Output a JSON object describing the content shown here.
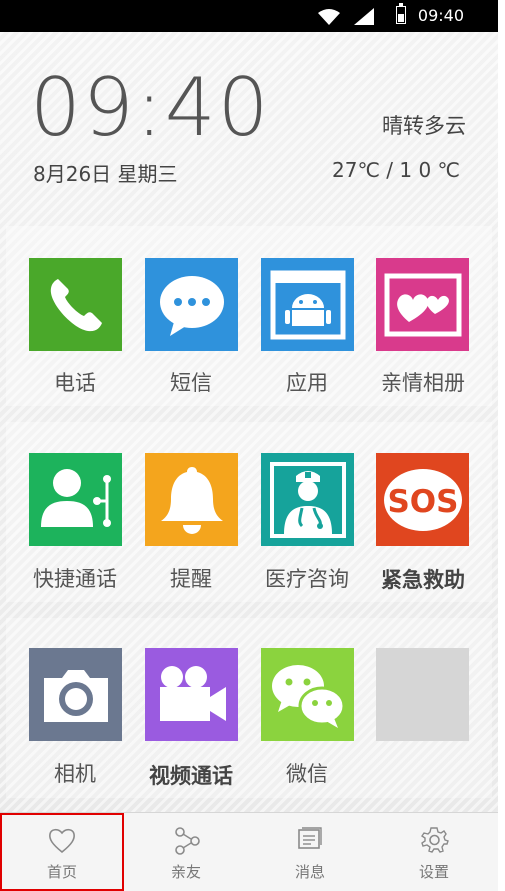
{
  "status_bar": {
    "time": "09:40"
  },
  "header": {
    "clock": "09:40",
    "date": "8月26日  星期三",
    "weather": "晴转多云",
    "temperature": "27℃ / 1 0 ℃"
  },
  "apps": [
    {
      "label": "电话",
      "color": "#4aa82a",
      "icon": "phone-icon"
    },
    {
      "label": "短信",
      "color": "#2f92dc",
      "icon": "message-bubble-icon"
    },
    {
      "label": "应用",
      "color": "#2f92dc",
      "icon": "android-icon"
    },
    {
      "label": "亲情相册",
      "color": "#d93a8c",
      "icon": "heart-album-icon"
    },
    {
      "label": "快捷通话",
      "color": "#1db35c",
      "icon": "contact-share-icon"
    },
    {
      "label": "提醒",
      "color": "#f4a51d",
      "icon": "bell-icon"
    },
    {
      "label": "医疗咨询",
      "color": "#16a39b",
      "icon": "doctor-icon"
    },
    {
      "label": "紧急救助",
      "color": "#e0461f",
      "icon": "sos-icon"
    },
    {
      "label": "相机",
      "color": "#6b7890",
      "icon": "camera-icon"
    },
    {
      "label": "视频通话",
      "color": "#9a5be0",
      "icon": "video-camera-icon"
    },
    {
      "label": "微信",
      "color": "#8bd33e",
      "icon": "wechat-icon"
    },
    {
      "label": "",
      "color": "#d6d6d6",
      "icon": "empty-slot"
    }
  ],
  "bottom_nav": {
    "items": [
      {
        "label": "首页",
        "icon": "heart-icon",
        "selected": true
      },
      {
        "label": "亲友",
        "icon": "share-nodes-icon",
        "selected": false
      },
      {
        "label": "消息",
        "icon": "message-list-icon",
        "selected": false
      },
      {
        "label": "设置",
        "icon": "gear-icon",
        "selected": false
      }
    ]
  }
}
